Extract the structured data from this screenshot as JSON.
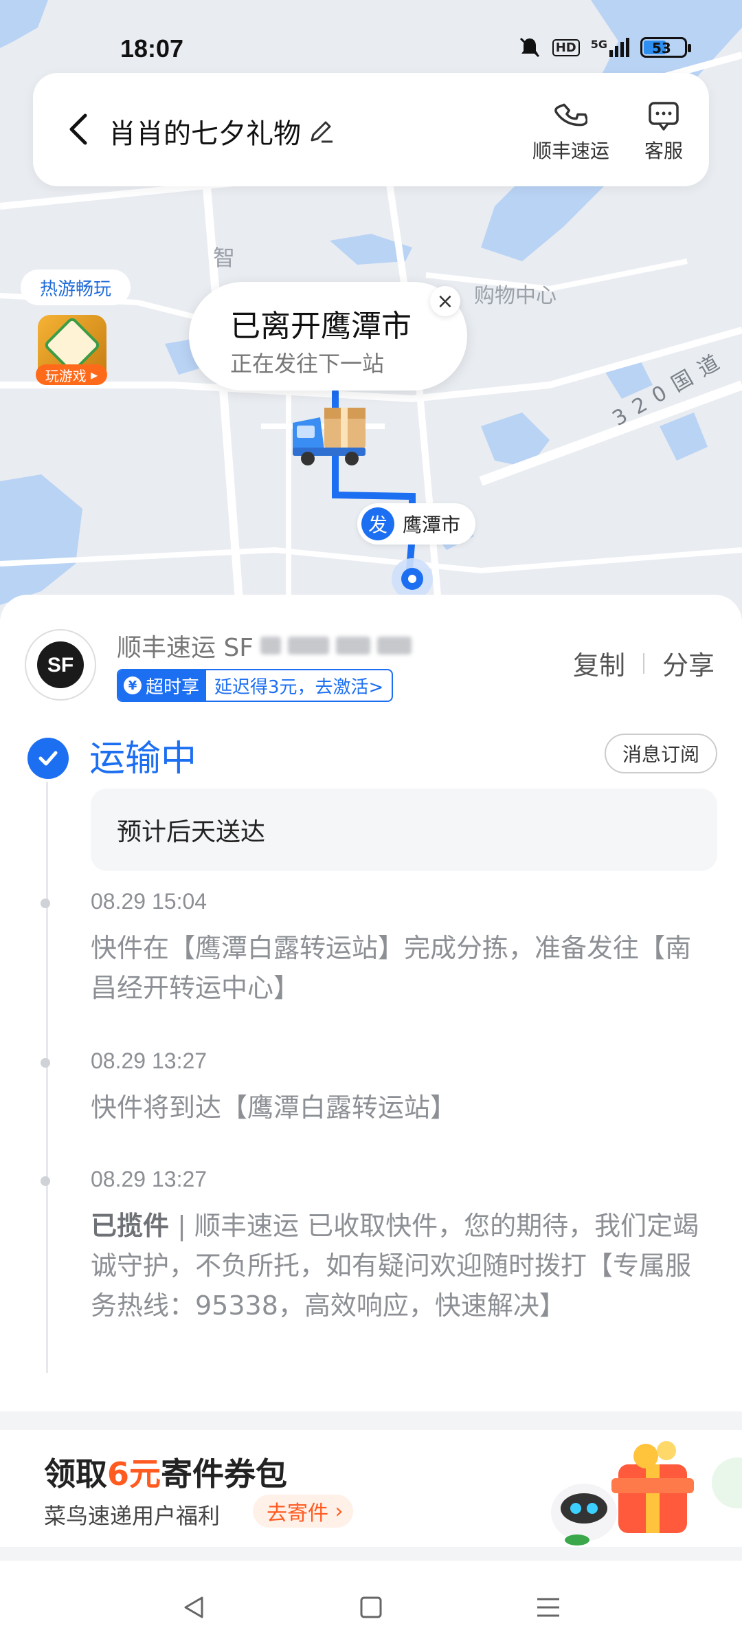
{
  "status_bar": {
    "time": "18:07",
    "battery": "53",
    "network": "5G",
    "hd": "HD"
  },
  "header": {
    "title": "肖肖的七夕礼物",
    "actions": [
      {
        "label": "顺丰速运",
        "icon": "phone-icon"
      },
      {
        "label": "客服",
        "icon": "chat-icon"
      }
    ]
  },
  "map": {
    "promo_label": "热游畅玩",
    "game_button": "玩游戏",
    "bubble_title": "已离开鹰潭市",
    "bubble_subtitle": "正在发往下一站",
    "origin_badge": "发",
    "origin_city": "鹰潭市",
    "labels": {
      "shopping": "购物中心",
      "road": "320国道",
      "zhi": "智"
    }
  },
  "shipment": {
    "courier_prefix": "顺丰速运 SF",
    "sla_badge": "超时享",
    "sla_text": "延迟得3元，去激活>",
    "copy_label": "复制",
    "share_label": "分享",
    "status": "运输中",
    "subscribe_label": "消息订阅",
    "eta": "预计后天送达",
    "events": [
      {
        "time": "08.29 15:04",
        "desc": "快件在【鹰潭白露转运站】完成分拣，准备发往【南昌经开转运中心】"
      },
      {
        "time": "08.29 13:27",
        "desc": "快件将到达【鹰潭白露转运站】"
      },
      {
        "time": "08.29 13:27",
        "desc_bold": "已揽件",
        "desc": "顺丰速运 已收取快件，您的期待，我们定竭诚守护，不负所托，如有疑问欢迎随时拨打【专属服务热线：95338，高效响应，快速解决】"
      }
    ]
  },
  "coupon": {
    "title_prefix": "领取",
    "title_highlight": "6元",
    "title_suffix": "寄件券包",
    "subtitle": "菜鸟速递用户福利",
    "button": "去寄件"
  },
  "colors": {
    "accent": "#1d6ff2",
    "orange": "#ff5a1f"
  }
}
